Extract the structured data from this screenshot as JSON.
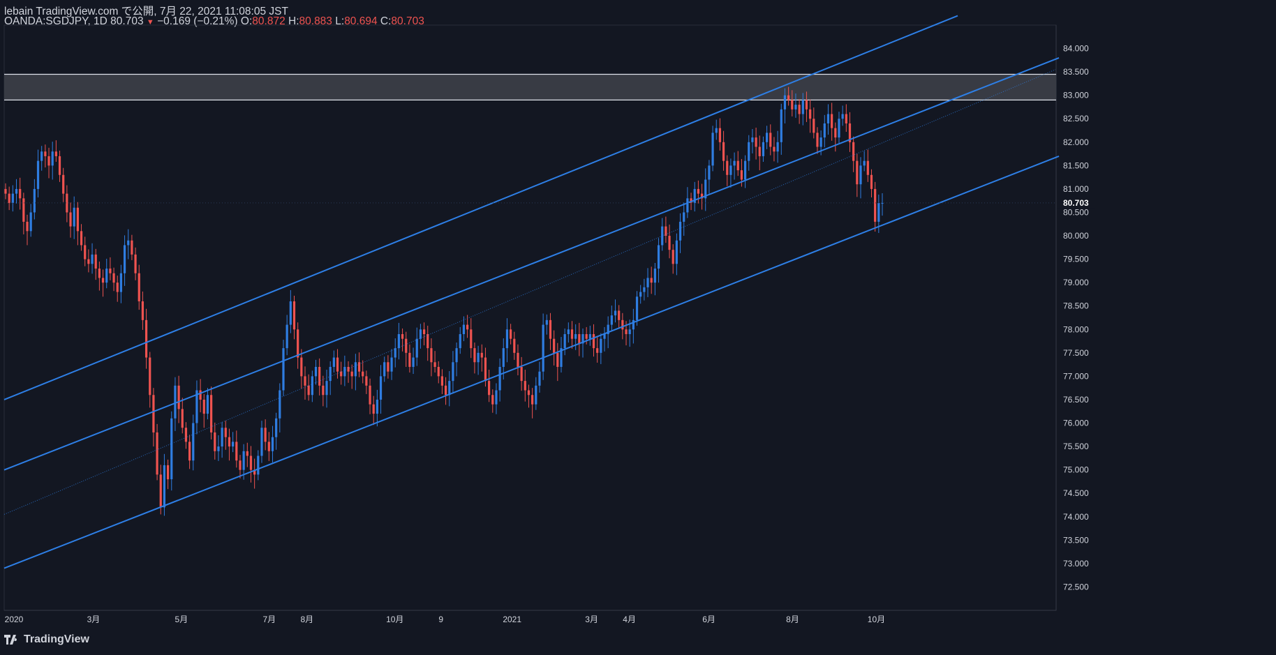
{
  "header": {
    "line1": "lebain TradingView.com で公開, 7月 22, 2021 11:08:05 JST",
    "symbol": "OANDA:SGDJPY, 1D 80.703",
    "change": "−0.169 (−0.21%)",
    "o_label": "O:",
    "o_value": "80.872",
    "h_label": "H:",
    "h_value": "80.883",
    "l_label": "L:",
    "l_value": "80.694",
    "c_label": "C:",
    "c_value": "80.703"
  },
  "brand": {
    "name": "TradingView"
  },
  "colors": {
    "background": "#131722",
    "up": "#2f7de1",
    "down": "#ef5350",
    "channel": "#2e7fe6",
    "zone": "#3a3d47",
    "text": "#d1d4dc"
  },
  "chart_data": {
    "type": "candlestick",
    "symbol": "OANDA:SGDJPY",
    "interval": "1D",
    "last_price": "80.703",
    "ylim": [
      72.0,
      84.5
    ],
    "y_ticks": [
      "84.000",
      "83.500",
      "83.000",
      "82.500",
      "82.000",
      "81.500",
      "81.000",
      "80.500",
      "80.000",
      "79.500",
      "79.000",
      "78.500",
      "78.000",
      "77.500",
      "77.000",
      "76.500",
      "76.000",
      "75.500",
      "75.000",
      "74.500",
      "74.000",
      "73.500",
      "73.000",
      "72.500"
    ],
    "x_labels": [
      "2020",
      "3月",
      "5月",
      "7月",
      "8月",
      "10月",
      "9",
      "2021",
      "3月",
      "4月",
      "6月",
      "8月",
      "10月"
    ],
    "resistance_zone": [
      82.9,
      83.45
    ],
    "channel_lines": [
      {
        "name": "upper",
        "from": [
          0,
          76.5
        ],
        "to": [
          1366,
          84.7
        ]
      },
      {
        "name": "middle",
        "from": [
          0,
          75.0
        ],
        "to": [
          1511,
          83.8
        ]
      },
      {
        "name": "lower",
        "from": [
          0,
          72.9
        ],
        "to": [
          1511,
          81.7
        ]
      }
    ],
    "closes": [
      80.9,
      80.7,
      80.9,
      81.0,
      80.8,
      80.3,
      80.1,
      80.5,
      81.0,
      81.6,
      81.8,
      81.7,
      81.5,
      81.8,
      81.7,
      81.3,
      80.9,
      80.5,
      80.2,
      80.6,
      80.1,
      79.8,
      79.5,
      79.4,
      79.6,
      79.3,
      79.1,
      79.0,
      79.3,
      79.2,
      79.0,
      78.8,
      79.2,
      79.8,
      79.9,
      79.6,
      79.2,
      78.6,
      78.2,
      77.4,
      76.6,
      75.8,
      74.9,
      74.2,
      75.1,
      74.8,
      76.1,
      76.8,
      76.3,
      75.9,
      75.6,
      75.2,
      76.0,
      76.7,
      76.5,
      76.2,
      76.6,
      75.8,
      75.4,
      75.5,
      75.9,
      75.7,
      75.5,
      75.6,
      75.2,
      75.0,
      75.4,
      75.3,
      75.0,
      74.9,
      75.3,
      75.9,
      75.6,
      75.4,
      75.7,
      76.1,
      76.7,
      77.6,
      78.1,
      78.6,
      78.0,
      77.4,
      77.0,
      76.8,
      76.6,
      77.0,
      77.2,
      76.8,
      76.6,
      76.9,
      77.2,
      77.4,
      77.1,
      77.0,
      77.2,
      77.1,
      77.0,
      77.3,
      77.1,
      77.0,
      76.8,
      76.4,
      76.2,
      76.5,
      77.0,
      77.3,
      77.1,
      77.4,
      77.6,
      77.9,
      77.8,
      77.5,
      77.2,
      77.4,
      77.8,
      78.0,
      77.9,
      77.6,
      77.3,
      77.2,
      77.0,
      76.8,
      76.6,
      76.9,
      77.3,
      77.6,
      77.9,
      78.1,
      78.0,
      77.6,
      77.3,
      77.5,
      77.4,
      76.9,
      76.6,
      76.4,
      76.7,
      77.2,
      77.6,
      78.0,
      77.8,
      77.5,
      77.2,
      76.9,
      76.7,
      76.6,
      76.4,
      76.8,
      77.1,
      78.1,
      78.2,
      77.8,
      77.5,
      77.2,
      77.6,
      77.9,
      78.0,
      77.8,
      77.9,
      77.7,
      77.9,
      77.8,
      77.9,
      77.6,
      77.5,
      77.8,
      77.9,
      78.1,
      78.3,
      78.4,
      78.2,
      78.0,
      77.9,
      78.0,
      78.2,
      78.7,
      78.8,
      78.9,
      79.1,
      79.0,
      79.3,
      79.8,
      80.2,
      80.0,
      79.7,
      79.4,
      79.9,
      80.3,
      80.5,
      80.8,
      80.7,
      81.0,
      80.9,
      80.8,
      81.2,
      81.5,
      82.2,
      82.3,
      82.0,
      81.6,
      81.3,
      81.5,
      81.6,
      81.4,
      81.2,
      81.6,
      82.0,
      82.1,
      81.9,
      81.7,
      82.0,
      82.2,
      81.9,
      81.8,
      82.0,
      82.7,
      83.0,
      82.9,
      82.7,
      82.8,
      82.6,
      82.9,
      82.7,
      82.5,
      82.2,
      81.9,
      82.1,
      82.4,
      82.6,
      82.3,
      82.1,
      82.5,
      82.6,
      82.4,
      82.0,
      81.6,
      81.1,
      81.5,
      81.6,
      81.3,
      81.0,
      80.3,
      80.7,
      80.7
    ],
    "x_range": [
      "2019-12-31",
      "2021-11-15"
    ]
  }
}
